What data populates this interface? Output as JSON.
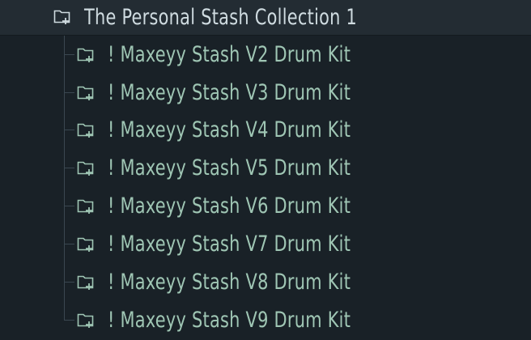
{
  "browser": {
    "parent": {
      "label": "The Personal Stash Collection 1",
      "icon": "folder-plus-icon"
    },
    "children": [
      {
        "label": "! Maxeyy Stash V2 Drum Kit",
        "icon": "folder-plus-icon"
      },
      {
        "label": "! Maxeyy Stash V3 Drum Kit",
        "icon": "folder-plus-icon"
      },
      {
        "label": "! Maxeyy Stash V4 Drum Kit",
        "icon": "folder-plus-icon"
      },
      {
        "label": "! Maxeyy Stash V5 Drum Kit",
        "icon": "folder-plus-icon"
      },
      {
        "label": "! Maxeyy Stash V6 Drum Kit",
        "icon": "folder-plus-icon"
      },
      {
        "label": "! Maxeyy Stash V7 Drum Kit",
        "icon": "folder-plus-icon"
      },
      {
        "label": "! Maxeyy Stash V8 Drum Kit",
        "icon": "folder-plus-icon"
      },
      {
        "label": "! Maxeyy Stash V9 Drum Kit",
        "icon": "folder-plus-icon"
      }
    ],
    "colors": {
      "background": "#192127",
      "parent_background": "#232c33",
      "parent_text": "#cfdbe0",
      "child_text": "#9fc6b4",
      "tree_lines": "#3a4750"
    }
  }
}
